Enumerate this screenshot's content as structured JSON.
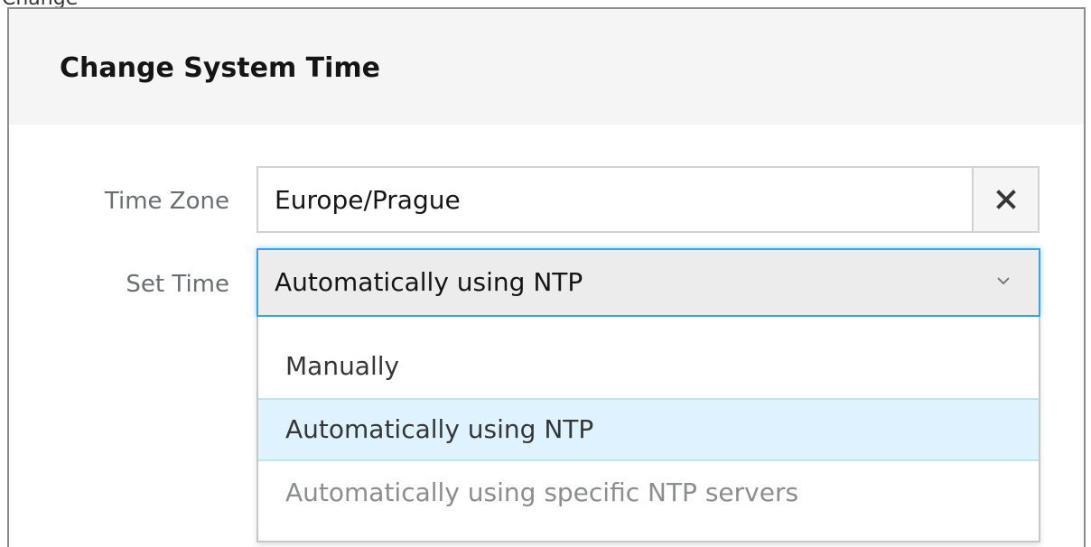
{
  "background": {
    "partial_text": "Change"
  },
  "dialog": {
    "title": "Change System Time"
  },
  "form": {
    "time_zone": {
      "label": "Time Zone",
      "value": "Europe/Prague",
      "clear_icon": "close-icon"
    },
    "set_time": {
      "label": "Set Time",
      "selected": "Automatically using NTP",
      "chevron_icon": "chevron-down-icon",
      "options": [
        {
          "label": "Manually",
          "state": "normal"
        },
        {
          "label": "Automatically using NTP",
          "state": "highlighted"
        },
        {
          "label": "Automatically using specific NTP servers",
          "state": "disabled"
        }
      ]
    }
  },
  "colors": {
    "header_bg": "#f5f5f5",
    "focus_border": "#39a5dc",
    "highlight_bg": "#def3ff",
    "disabled_text": "#8b8d8f"
  }
}
